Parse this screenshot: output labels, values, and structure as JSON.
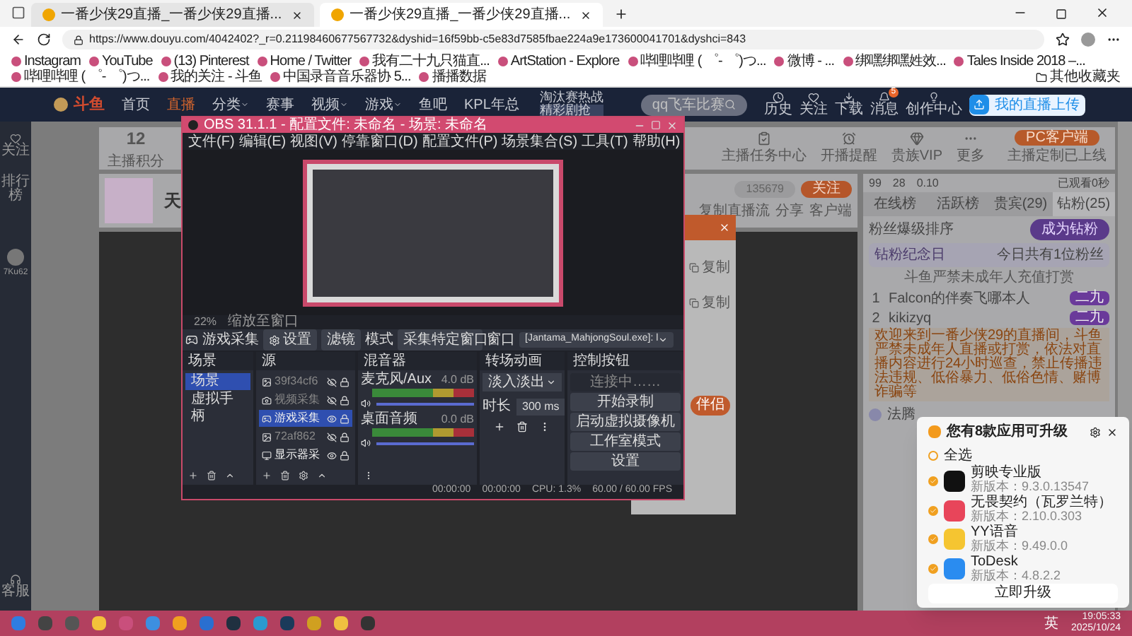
{
  "browser": {
    "tabs": [
      {
        "title": "一番少侠29直播_一番少侠29直播...",
        "selected": false
      },
      {
        "title": "一番少侠29直播_一番少侠29直播...",
        "selected": true
      }
    ],
    "url": "https://www.douyu.com/4042402?_r=0.21198460677567732&dyshid=16f59bb-c5e83d7585fbae224a9e173600041701&dyshci=843",
    "bookmarks": [
      "Instagram",
      "YouTube",
      "(13) Pinterest",
      "Home / Twitter",
      "我有二十九只猫直...",
      "ArtStation - Explore",
      "哔哩哔哩 ( ゜- ゜)つ...",
      "微博 - ...",
      "绑嘿绑嘿姓效...",
      "Tales Inside 2018 –...",
      "哔哩哔哩 ( ゜- ゜)つ...",
      "我的关注 - 斗鱼",
      "中国录音音乐器协 5...",
      "播播数据"
    ],
    "other_bookmarks": "其他收藏夹"
  },
  "site": {
    "logo": "斗鱼",
    "nav": [
      {
        "label": "首页",
        "selected": false,
        "dropdown": false
      },
      {
        "label": "直播",
        "selected": true,
        "dropdown": false
      },
      {
        "label": "分类",
        "selected": false,
        "dropdown": true
      },
      {
        "label": "赛事",
        "selected": false,
        "dropdown": false
      },
      {
        "label": "视频",
        "selected": false,
        "dropdown": true
      },
      {
        "label": "游戏",
        "selected": false,
        "dropdown": true
      },
      {
        "label": "鱼吧",
        "selected": false,
        "dropdown": false
      },
      {
        "label": "KPL年总",
        "selected": false,
        "dropdown": false
      }
    ],
    "promo": [
      "淘汰赛热战",
      "精彩剧抢"
    ],
    "search": {
      "placeholder": "qq飞车比赛"
    },
    "header_icons": [
      {
        "label": "历史"
      },
      {
        "label": "关注"
      },
      {
        "label": "下载"
      },
      {
        "label": "消息",
        "badge": "5"
      },
      {
        "label": "创作中心"
      }
    ],
    "upload_button": "我的直播上传",
    "sidebar": [
      "关注",
      "排行榜"
    ],
    "user": "7Ku62",
    "sidebar_bottom": "客服"
  },
  "stats": {
    "score": "12",
    "score_label": "主播积分",
    "items": [
      "主播任务中心",
      "开播提醒",
      "贵族VIP",
      "更多"
    ],
    "client_button": "PC客户端",
    "client_note": "主播定制已上线"
  },
  "stream": {
    "title": "天",
    "followers": "135679",
    "follow_button": "关注",
    "links": [
      "复制直播流",
      "分享",
      "客户端"
    ]
  },
  "dialog": {
    "copy_buttons": [
      "复制",
      "复制"
    ],
    "action": "伴侣"
  },
  "panel": {
    "counts": [
      "99",
      "28",
      "0.10"
    ],
    "watched": "已观看0秒",
    "tabs": [
      {
        "label": "在线榜",
        "selected": false
      },
      {
        "label": "活跃榜",
        "selected": false
      },
      {
        "label": "贵宾(29)",
        "selected": false
      },
      {
        "label": "钻粉(25)",
        "selected": true
      }
    ],
    "sort_label": "粉丝爆级排序",
    "join_button": "成为钻粉",
    "anniversary": {
      "title": "钻粉纪念日",
      "note": "今日共有1位粉丝"
    },
    "notice": "斗鱼严禁未成年人充值打赏",
    "ranks": [
      {
        "rank": "1",
        "name": "Falcon的伴奏飞哪本人",
        "badge": "二九"
      },
      {
        "rank": "2",
        "name": "kikizyq",
        "badge": "二九"
      }
    ],
    "welcome": "欢迎来到一番少侠29的直播间，斗鱼严禁未成年人直播或打赏，依法对直播内容进行24小时巡查，禁止传播违法违规、低俗暴力、低俗色情、赌博诈骗等",
    "chat": {
      "user": "法腾"
    }
  },
  "obs": {
    "title": "OBS 31.1.1 - 配置文件: 未命名 - 场景: 未命名",
    "menu": [
      "文件(F)",
      "编辑(E)",
      "视图(V)",
      "停靠窗口(D)",
      "配置文件(P)",
      "场景集合(S)",
      "工具(T)",
      "帮助(H)"
    ],
    "zoom": "22%",
    "zoom_mode": "缩放至窗口",
    "source_bar": {
      "name": "游戏采集",
      "settings": "设置",
      "filters": "滤镜",
      "mode_label": "模式",
      "mode": "采集特定窗口",
      "window_label": "窗口",
      "window": "[Jantama_MahjongSoul.exe]: l"
    },
    "docks": {
      "scenes": "场景",
      "sources": "源",
      "mixer": "混音器",
      "transitions": "转场动画",
      "controls": "控制按钮"
    },
    "scenes": [
      {
        "name": "场景",
        "selected": true
      },
      {
        "name": "虚拟手柄",
        "selected": false
      }
    ],
    "sources": [
      {
        "name": "39f34cf6",
        "kind": "image",
        "visible": false,
        "selected": false
      },
      {
        "name": "视频采集",
        "kind": "camera",
        "visible": false,
        "selected": false
      },
      {
        "name": "游戏采集",
        "kind": "game",
        "visible": true,
        "selected": true
      },
      {
        "name": "72af862",
        "kind": "image",
        "visible": false,
        "selected": false
      },
      {
        "name": "显示器采",
        "kind": "monitor",
        "visible": true,
        "selected": false
      }
    ],
    "mixer": [
      {
        "name": "麦克风/Aux",
        "db": "4.0 dB",
        "level": 1
      },
      {
        "name": "桌面音频",
        "db": "0.0 dB",
        "level": 1
      }
    ],
    "transition": "淡入淡出",
    "duration_label": "时长",
    "duration": "300 ms",
    "controls": [
      "连接中……",
      "开始录制",
      "启动虚拟摄像机",
      "工作室模式",
      "设置"
    ],
    "status": {
      "stream_time": "00:00:00",
      "record_time": "00:00:00",
      "cpu": "CPU: 1.3%",
      "fps": "60.00 / 60.00 FPS"
    }
  },
  "update_popup": {
    "title": "您有8款应用可升级",
    "select_all": {
      "label": "全选",
      "checked": false
    },
    "apps": [
      {
        "name": "剪映专业版",
        "version": "新版本：9.3.0.13547",
        "checked": true,
        "color": "#111111"
      },
      {
        "name": "无畏契约（瓦罗兰特）",
        "version": "新版本：2.10.0.303",
        "checked": true,
        "color": "#e8455a"
      },
      {
        "name": "YY语音",
        "version": "新版本：9.49.0.0",
        "checked": true,
        "color": "#f5c531"
      },
      {
        "name": "ToDesk",
        "version": "新版本：4.8.2.2",
        "checked": true,
        "color": "#2a8cf0"
      }
    ],
    "button": "立即升级"
  },
  "taskbar": {
    "language": "英",
    "time": "19:05:33",
    "date": "2025/10/24"
  }
}
